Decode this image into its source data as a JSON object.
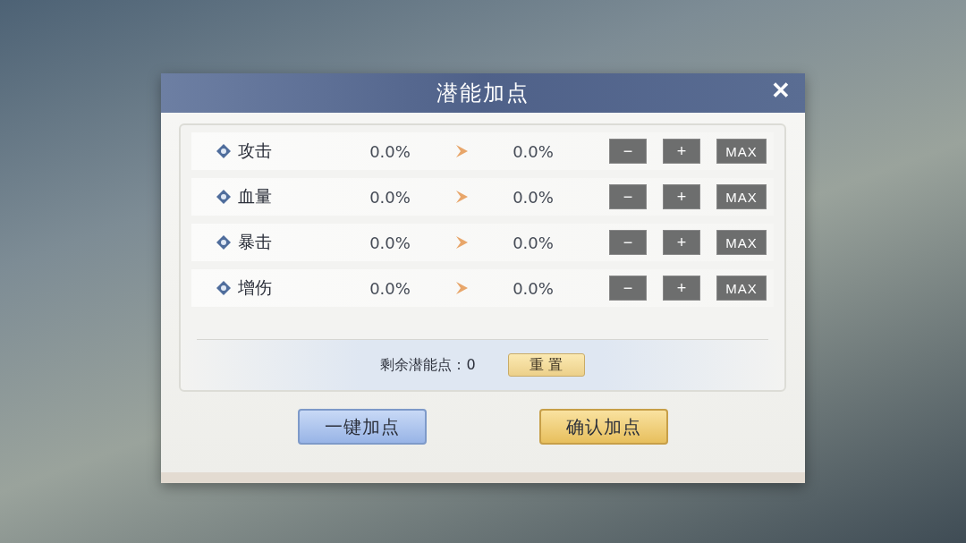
{
  "dialog": {
    "title": "潜能加点",
    "close": "✕"
  },
  "stats": [
    {
      "name": "攻击",
      "current": "0.0%",
      "next": "0.0%",
      "minus": "−",
      "plus": "+",
      "max": "MAX"
    },
    {
      "name": "血量",
      "current": "0.0%",
      "next": "0.0%",
      "minus": "−",
      "plus": "+",
      "max": "MAX"
    },
    {
      "name": "暴击",
      "current": "0.0%",
      "next": "0.0%",
      "minus": "−",
      "plus": "+",
      "max": "MAX"
    },
    {
      "name": "增伤",
      "current": "0.0%",
      "next": "0.0%",
      "minus": "−",
      "plus": "+",
      "max": "MAX"
    }
  ],
  "remaining": {
    "label": "剩余潜能点：0",
    "reset": "重 置"
  },
  "buttons": [
    {
      "label": "一键加点",
      "kind": "secondary"
    },
    {
      "label": "确认加点",
      "kind": "primary"
    }
  ]
}
